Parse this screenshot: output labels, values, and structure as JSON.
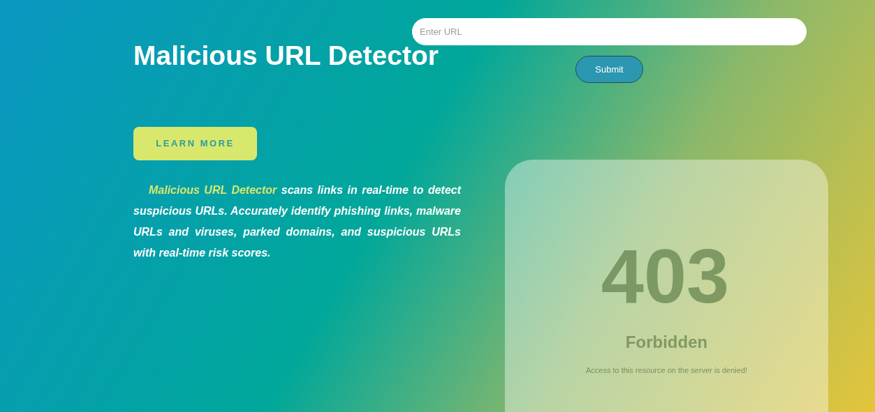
{
  "header": {
    "title": "Malicious URL Detector"
  },
  "url_form": {
    "placeholder": "Enter URL",
    "submit": "Submit"
  },
  "learn_more": "LEARN MORE",
  "intro": {
    "highlight": "Malicious URL Detector",
    "text": " scans links in real-time to detect suspicious URLs. Accurately identify phishing links, malware URLs and viruses, parked domains, and suspicious URLs with real-time risk scores."
  },
  "error_card": {
    "code": "403",
    "title": "Forbidden",
    "message": "Access to this resource on the server is denied!"
  }
}
